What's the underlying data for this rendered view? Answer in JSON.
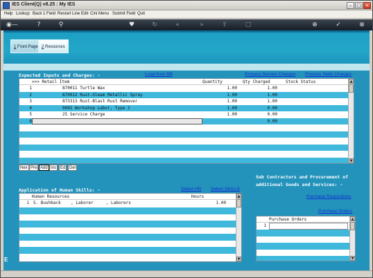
{
  "window": {
    "title": "IES Client(Q) v8.25 : My IES",
    "minimize_icon": "minimize-icon",
    "restore_icon": "restore-icon",
    "close_icon": "close-icon"
  },
  "menu": {
    "items": [
      "Help",
      "Lookup",
      "Back 1 Field",
      "Restart Line Edit",
      "Cini Menu",
      "Submit Field",
      "Quit"
    ]
  },
  "toolbar": {
    "icons": [
      "key-icon",
      "help-icon",
      "search-icon",
      "heart-icon",
      "refresh-icon",
      "rewind-icon",
      "forward-icon",
      "upload-icon",
      "document-icon",
      "add-icon",
      "check-icon",
      "close-icon"
    ]
  },
  "tabs": [
    {
      "num": "1",
      "label": " Front Page"
    },
    {
      "num": "2",
      "label": " Resources"
    }
  ],
  "inputs_section": {
    "title": "Expected Inputs and Charges: -",
    "links": {
      "load_from_bill": "Load from Bill",
      "process_service": "Process Service Charges",
      "process_skills": "Process Skills Charges"
    },
    "columns": [
      ">>> Retail Item",
      "Quantity",
      "Qty Charged",
      "Stock Status"
    ],
    "rows": [
      {
        "n": "1",
        "item": "870011 Turtle Wax",
        "qty": "1.00",
        "charged": "1.00",
        "stock": ""
      },
      {
        "n": "2",
        "item": "870012 Rust-Gleam Metallic Spray",
        "qty": "1.00",
        "charged": "1.00",
        "stock": ""
      },
      {
        "n": "3",
        "item": "873313 Rust-Blast Rust Remover",
        "qty": "1.00",
        "charged": "1.00",
        "stock": ""
      },
      {
        "n": "4",
        "item": "9002 Workshop Labor, Type 2",
        "qty": "1.00",
        "charged": "0.00",
        "stock": ""
      },
      {
        "n": "5",
        "item": "25 Service Charge",
        "qty": "1.00",
        "charged": "0.00",
        "stock": ""
      },
      {
        "n": "6",
        "item": "",
        "qty": "",
        "charged": "0.00",
        "stock": ""
      }
    ],
    "nav_buttons": [
      "Nex",
      "Pre",
      "Add",
      "Ins",
      "Ed",
      "Del"
    ]
  },
  "skills_section": {
    "title": "Application of Human Skills: -",
    "links": {
      "select_hr": "Select HR",
      "select_skills": "Select SKILLS"
    },
    "columns": [
      "Human Resources",
      "Hours"
    ],
    "rows": [
      {
        "n": "1",
        "resource": "S. Bushback    , Laborer     , Laborers",
        "hours": "1.00"
      }
    ]
  },
  "subcontract_section": {
    "title_line1": "Sub Contractors and Procurement of",
    "title_line2": "additional Goods and Services: -",
    "links": {
      "purchase_requisitions": "Purchase Requisitions",
      "purchase_orders": "Purchase Orders"
    },
    "columns": [
      "Purchase Orders"
    ],
    "rows": [
      {
        "n": "1",
        "order": ""
      }
    ]
  },
  "side_mark": "E",
  "colors": {
    "panel": "#2493bb",
    "row_alt": "#3fb8dc",
    "link": "#1030d0",
    "toolbar": "#1e2730"
  }
}
